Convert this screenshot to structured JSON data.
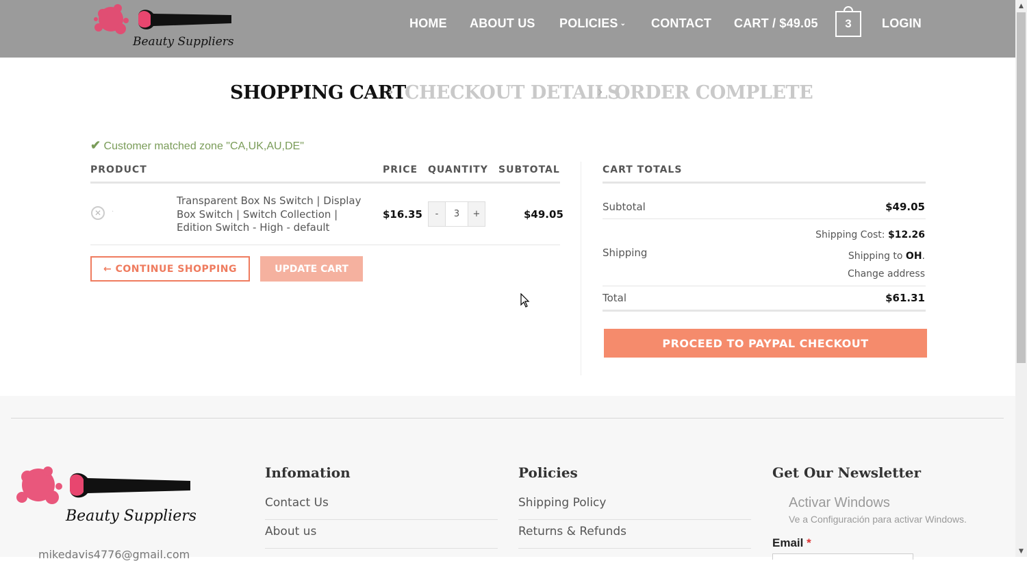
{
  "header": {
    "brand": "Beauty Suppliers",
    "nav": {
      "home": "HOME",
      "about": "ABOUT US",
      "policies": "POLICIES",
      "contact": "CONTACT",
      "cart": "CART / $49.05",
      "cart_count": "3",
      "login": "LOGIN"
    }
  },
  "steps": {
    "shopping_cart": "SHOPPING CART",
    "checkout_details": "CHECKOUT DETAILS",
    "order_complete": "ORDER COMPLETE"
  },
  "notice": "Customer matched zone \"CA,UK,AU,DE\"",
  "cart_table": {
    "headers": {
      "product": "PRODUCT",
      "price": "PRICE",
      "quantity": "QUANTITY",
      "subtotal": "SUBTOTAL"
    },
    "items": [
      {
        "name": "Transparent Box Ns Switch | Display Box Switch | Switch Collection | Edition Switch - High - default",
        "price": "$16.35",
        "quantity": "3",
        "subtotal": "$49.05"
      }
    ],
    "qty_minus": "-",
    "qty_plus": "+",
    "continue_shopping": "← CONTINUE SHOPPING",
    "update_cart": "UPDATE CART"
  },
  "totals": {
    "title": "CART TOTALS",
    "subtotal_label": "Subtotal",
    "subtotal_value": "$49.05",
    "shipping_label": "Shipping",
    "shipping_cost_label": "Shipping Cost:",
    "shipping_cost_value": "$12.26",
    "shipping_to_prefix": "Shipping to",
    "shipping_to_state": "OH",
    "change_address": "Change address",
    "total_label": "Total",
    "total_value": "$61.31",
    "checkout_button": "PROCEED TO PAYPAL CHECKOUT"
  },
  "footer": {
    "brand": "Beauty Suppliers",
    "email_partial": "mikedavis4776@gmail.com",
    "information": {
      "title": "Infomation",
      "links": [
        "Contact Us",
        "About us"
      ]
    },
    "policies": {
      "title": "Policies",
      "links": [
        "Shipping Policy",
        "Returns & Refunds"
      ]
    },
    "newsletter": {
      "title": "Get Our Newsletter",
      "email_label": "Email",
      "required_mark": "*"
    },
    "windows_watermark": {
      "line1": "Activar Windows",
      "line2": "Ve a Configuración para activar Windows."
    }
  },
  "colors": {
    "header_bg": "#9b9b9b",
    "accent": "#f58b6c",
    "notice_green": "#7a9c59"
  }
}
